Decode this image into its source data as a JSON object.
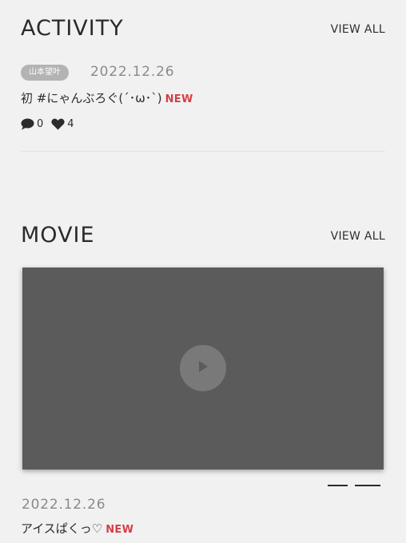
{
  "activity": {
    "title": "ACTIVITY",
    "view_all": "VIEW ALL",
    "post": {
      "author": "山本望叶",
      "date": "2022.12.26",
      "title": "初 #にゃんぶろぐ(´･ω･`)",
      "new_label": "NEW",
      "comments": "0",
      "likes": "4"
    }
  },
  "movie": {
    "title": "MOVIE",
    "view_all": "VIEW ALL",
    "video": {
      "date": "2022.12.26",
      "title": "アイスぱくっ♡",
      "new_label": "NEW"
    },
    "pager": {
      "count": 2,
      "active": 1
    }
  },
  "colors": {
    "background": "#f1f1f1",
    "new_badge": "#d34047",
    "video_placeholder": "#5b5b5b",
    "author_badge": "#b3b3b3"
  },
  "icons": {
    "comment": "speech-bubble-icon",
    "like": "heart-icon",
    "play": "play-icon"
  }
}
